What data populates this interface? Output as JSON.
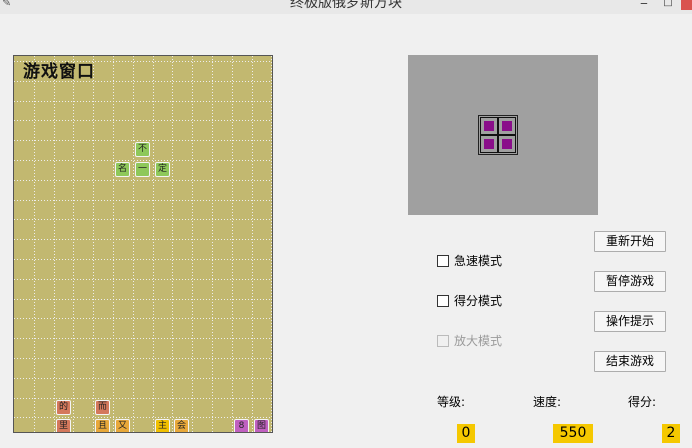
{
  "window": {
    "title": "终极版俄罗斯方块",
    "minimize_glyph": "‒",
    "maximize_glyph": "□"
  },
  "board": {
    "title": "游戏窗口",
    "falling_piece": [
      {
        "col": 6,
        "row": 4,
        "char": "不",
        "color": "#8ec85a"
      },
      {
        "col": 5,
        "row": 5,
        "char": "名",
        "color": "#8ec85a"
      },
      {
        "col": 6,
        "row": 5,
        "char": "一",
        "color": "#8ec85a"
      },
      {
        "col": 7,
        "row": 5,
        "char": "定",
        "color": "#8ec85a"
      }
    ],
    "settled_cells": [
      {
        "col": 2,
        "row": 17,
        "char": "的",
        "color": "#d4785c"
      },
      {
        "col": 4,
        "row": 17,
        "char": "而",
        "color": "#d4785c"
      },
      {
        "col": 2,
        "row": 18,
        "char": "里",
        "color": "#d4785c"
      },
      {
        "col": 4,
        "row": 18,
        "char": "且",
        "color": "#e8a83a"
      },
      {
        "col": 5,
        "row": 18,
        "char": "又",
        "color": "#e8a83a"
      },
      {
        "col": 7,
        "row": 18,
        "char": "主",
        "color": "#f0c000"
      },
      {
        "col": 8,
        "row": 18,
        "char": "会",
        "color": "#e8a83a"
      },
      {
        "col": 11,
        "row": 18,
        "char": "8",
        "color": "#c060c0"
      },
      {
        "col": 12,
        "row": 18,
        "char": "图",
        "color": "#c060c0"
      },
      {
        "col": 1,
        "row": 19,
        "char": "配",
        "color": "#d4785c"
      },
      {
        "col": 2,
        "row": 19,
        "char": "置",
        "color": "#d4785c"
      },
      {
        "col": 4,
        "row": 19,
        "char": "件",
        "color": "#e8a83a"
      },
      {
        "col": 5,
        "row": 19,
        "char": "件",
        "color": "#e8a83a"
      },
      {
        "col": 6,
        "row": 19,
        "char": "",
        "color": "#8a00b0"
      },
      {
        "col": 7,
        "row": 19,
        "char": "效",
        "color": "#f0c000"
      },
      {
        "col": 8,
        "row": 19,
        "char": "后",
        "color": "#e8a83a"
      },
      {
        "col": 11,
        "row": 19,
        "char": "文",
        "color": "#e8a83a"
      },
      {
        "col": 12,
        "row": 19,
        "char": "到",
        "color": "#c060c0"
      }
    ]
  },
  "preview": {
    "piece_color": "#8a0f8a"
  },
  "buttons": {
    "restart": "重新开始",
    "pause": "暂停游戏",
    "help": "操作提示",
    "end": "结束游戏"
  },
  "modes": {
    "fast": {
      "label": "急速模式",
      "checked": false,
      "enabled": true
    },
    "score": {
      "label": "得分模式",
      "checked": false,
      "enabled": true
    },
    "zoom": {
      "label": "放大模式",
      "checked": false,
      "enabled": false
    }
  },
  "stats": {
    "level_label": "等级:",
    "speed_label": "速度:",
    "score_label": "得分:",
    "level": "0",
    "speed": "550",
    "score": "2"
  }
}
